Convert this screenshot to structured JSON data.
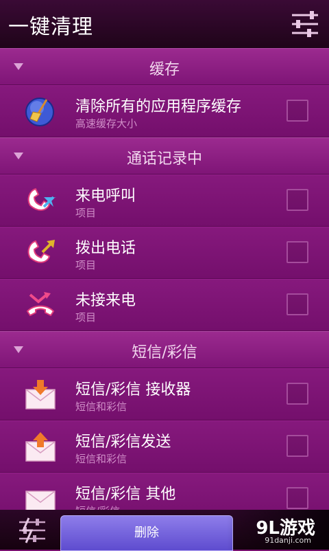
{
  "header": {
    "title": "一键清理",
    "settings_icon": "equalizer-settings-icon"
  },
  "sections": [
    {
      "label": "缓存",
      "items": [
        {
          "title": "清除所有的应用程序缓存",
          "subtitle": "高速缓存大小",
          "icon": "broom-clean-icon",
          "checked": false
        }
      ]
    },
    {
      "label": "通话记录中",
      "items": [
        {
          "title": "来电呼叫",
          "subtitle": "项目",
          "icon": "incoming-call-icon",
          "checked": false
        },
        {
          "title": "拨出电话",
          "subtitle": "项目",
          "icon": "outgoing-call-icon",
          "checked": false
        },
        {
          "title": "未接来电",
          "subtitle": "项目",
          "icon": "missed-call-icon",
          "checked": false
        }
      ]
    },
    {
      "label": "短信/彩信",
      "items": [
        {
          "title": "短信/彩信 接收器",
          "subtitle": "短信和彩信",
          "icon": "inbox-mail-icon",
          "checked": false
        },
        {
          "title": "短信/彩信发送",
          "subtitle": "短信和彩信",
          "icon": "sent-mail-icon",
          "checked": false
        },
        {
          "title": "短信/彩信 其他",
          "subtitle": "短信/彩信",
          "icon": "other-mail-icon",
          "checked": false
        }
      ]
    }
  ],
  "footer": {
    "delete_label": "删除",
    "left_icon": "equalizer-settings-icon",
    "watermark_logo": "9L游戏",
    "watermark_url": "91danji.com"
  },
  "colors": {
    "background": "#7a1170",
    "header": "#2a0626",
    "accent_button": "#6f5ddb"
  }
}
